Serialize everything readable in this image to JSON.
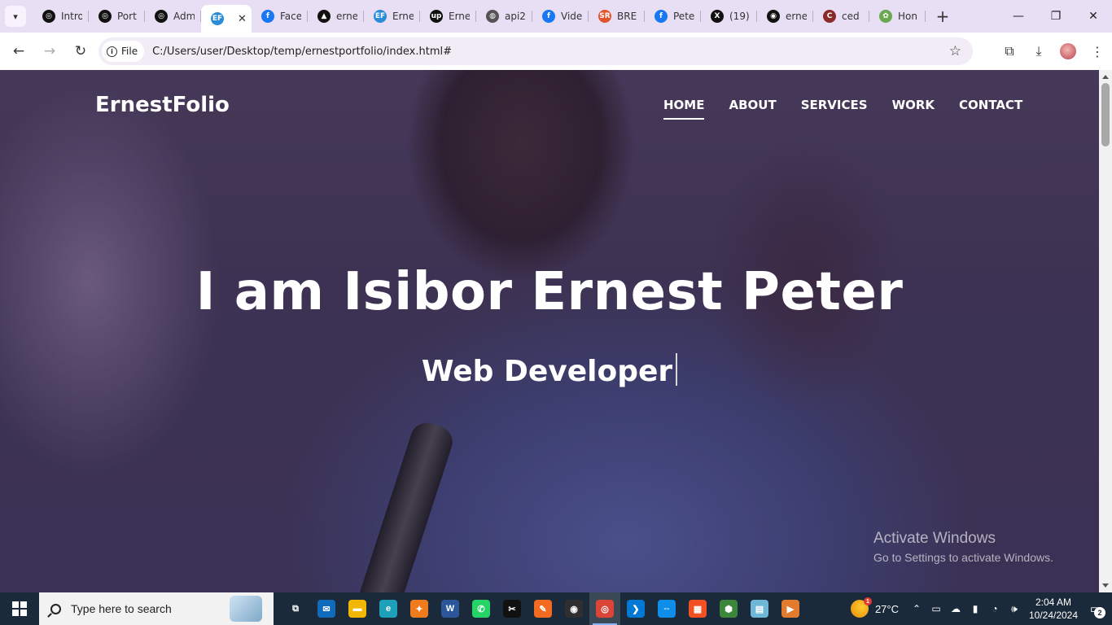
{
  "browser": {
    "tabs": [
      {
        "title": "Intro",
        "favicon": "openai-icon",
        "color": "#111111",
        "glyph": "◎"
      },
      {
        "title": "Port",
        "favicon": "openai-icon",
        "color": "#111111",
        "glyph": "◎"
      },
      {
        "title": "Adm",
        "favicon": "openai-icon",
        "color": "#111111",
        "glyph": "◎"
      },
      {
        "title": "EF",
        "favicon": "ernestfolio-icon",
        "color": "#2a8bd6",
        "glyph": "EF",
        "active": true
      },
      {
        "title": "Face",
        "favicon": "facebook-icon",
        "color": "#1877f2",
        "glyph": "f"
      },
      {
        "title": "erne",
        "favicon": "vercel-icon",
        "color": "#111111",
        "glyph": "▲"
      },
      {
        "title": "Erne",
        "favicon": "ernestfolio-icon",
        "color": "#2a8bd6",
        "glyph": "EF"
      },
      {
        "title": "Erne",
        "favicon": "upwork-icon",
        "color": "#111111",
        "glyph": "up"
      },
      {
        "title": "api2",
        "favicon": "globe-icon",
        "color": "#555555",
        "glyph": "◍"
      },
      {
        "title": "Vide",
        "favicon": "facebook-icon",
        "color": "#1877f2",
        "glyph": "f"
      },
      {
        "title": "BRE",
        "favicon": "sr-icon",
        "color": "#e2542d",
        "glyph": "SR"
      },
      {
        "title": "Pete",
        "favicon": "facebook-icon",
        "color": "#1877f2",
        "glyph": "f"
      },
      {
        "title": "(19)",
        "favicon": "x-icon",
        "color": "#111111",
        "glyph": "X"
      },
      {
        "title": "erne",
        "favicon": "github-icon",
        "color": "#111111",
        "glyph": "◉"
      },
      {
        "title": "ced",
        "favicon": "cedar-icon",
        "color": "#8a2b2b",
        "glyph": "C"
      },
      {
        "title": "Hon",
        "favicon": "pinwheel-icon",
        "color": "#6aa84f",
        "glyph": "✿"
      }
    ],
    "tab_search_glyph": "▾",
    "new_tab_glyph": "+",
    "close_tab_glyph": "✕",
    "window": {
      "minimize": "—",
      "restore": "❐",
      "close": "✕"
    },
    "nav": {
      "back": "←",
      "forward": "→",
      "reload": "↻"
    },
    "address": {
      "chip_label": "File",
      "url": "C:/Users/user/Desktop/temp/ernestportfolio/index.html#",
      "bookmark_glyph": "☆"
    },
    "toolbar_right": {
      "extensions": "⧉",
      "downloads": "⤓",
      "menu": "⋮"
    }
  },
  "page": {
    "brand": "ErnestFolio",
    "nav": [
      {
        "label": "HOME",
        "current": true
      },
      {
        "label": "ABOUT"
      },
      {
        "label": "SERVICES"
      },
      {
        "label": "WORK"
      },
      {
        "label": "CONTACT"
      }
    ],
    "hero_title": "I am Isibor Ernest Peter",
    "hero_subtitle": "Web Developer",
    "watermark": {
      "line1": "Activate Windows",
      "line2": "Go to Settings to activate Windows."
    }
  },
  "taskbar": {
    "search_placeholder": "Type here to search",
    "apps": [
      {
        "name": "task-view",
        "glyph": "⧉",
        "color": "#1b2a3a"
      },
      {
        "name": "mail",
        "glyph": "✉",
        "color": "#0f6cbd"
      },
      {
        "name": "file-explorer",
        "glyph": "▬",
        "color": "#f2b705"
      },
      {
        "name": "edge",
        "glyph": "e",
        "color": "#1da1b8"
      },
      {
        "name": "app-orange",
        "glyph": "✦",
        "color": "#f07b1d"
      },
      {
        "name": "word",
        "glyph": "W",
        "color": "#2b579a"
      },
      {
        "name": "whatsapp",
        "glyph": "✆",
        "color": "#25d366"
      },
      {
        "name": "capcut",
        "glyph": "✂",
        "color": "#111111"
      },
      {
        "name": "app-pen",
        "glyph": "✎",
        "color": "#f26b21"
      },
      {
        "name": "obs",
        "glyph": "◉",
        "color": "#302e31"
      },
      {
        "name": "chrome",
        "glyph": "◎",
        "color": "#db4437",
        "active": true
      },
      {
        "name": "vscode",
        "glyph": "❯",
        "color": "#0078d4"
      },
      {
        "name": "teamviewer",
        "glyph": "⇔",
        "color": "#0e8ee9"
      },
      {
        "name": "store",
        "glyph": "▦",
        "color": "#f25022"
      },
      {
        "name": "node",
        "glyph": "⬢",
        "color": "#3c873a"
      },
      {
        "name": "notes",
        "glyph": "▤",
        "color": "#6fb7d6"
      },
      {
        "name": "media-player",
        "glyph": "▶",
        "color": "#e37b2f"
      }
    ],
    "weather": {
      "temp": "27°C",
      "badge": "1"
    },
    "tray_glyphs": [
      "⌃",
      "▭",
      "☁",
      "▮",
      "◔",
      "🕪"
    ],
    "time": "2:04 AM",
    "date": "10/24/2024",
    "notifications": "2"
  }
}
